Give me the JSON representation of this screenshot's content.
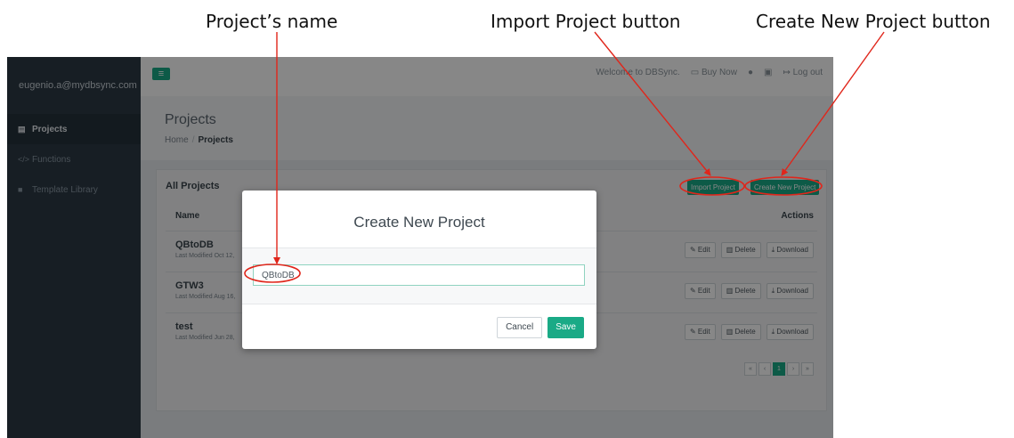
{
  "annotations": {
    "project_name": "Project’s name",
    "import_project": "Import Project button",
    "create_new_project": "Create New Project button"
  },
  "colors": {
    "accent": "#1aaa86",
    "sidebar": "#2c3a45",
    "annotation": "#e0261b"
  },
  "sidebar": {
    "account": "eugenio.a@mydbsync.com",
    "items": [
      {
        "label": "Projects",
        "icon": "table-icon",
        "active": true
      },
      {
        "label": "Functions",
        "icon": "code-icon",
        "active": false
      },
      {
        "label": "Template Library",
        "icon": "briefcase-icon",
        "active": false
      }
    ]
  },
  "topbar": {
    "menu_icon": "hamburger-icon",
    "welcome": "Welcome to DBSync.",
    "buy_now": "Buy Now",
    "log_out": "Log out"
  },
  "page": {
    "title": "Projects",
    "breadcrumb": {
      "home": "Home",
      "sep": "/",
      "current": "Projects"
    }
  },
  "panel": {
    "title": "All Projects",
    "import_button": "Import Project",
    "create_button": "Create New Project",
    "columns": {
      "name": "Name",
      "actions": "Actions"
    },
    "rows": [
      {
        "name": "QBtoDB",
        "meta": "Last Modified Oct 12,"
      },
      {
        "name": "GTW3",
        "meta": "Last Modified Aug 16,"
      },
      {
        "name": "test",
        "meta": "Last Modified Jun 28,"
      }
    ],
    "row_actions": {
      "edit": "Edit",
      "delete": "Delete",
      "download": "Download"
    },
    "pagination": [
      "«",
      "‹",
      "1",
      "›",
      "»"
    ]
  },
  "modal": {
    "title": "Create New Project",
    "input_value": "QBtoDB",
    "cancel": "Cancel",
    "save": "Save"
  }
}
